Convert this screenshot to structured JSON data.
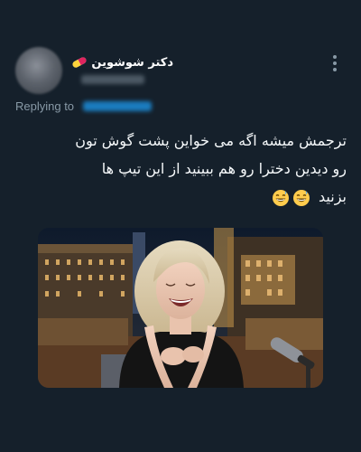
{
  "tweet": {
    "author_name": "دکتر شوشوین",
    "name_badge_icon": "pill-icon",
    "replying_label": "Replying to",
    "text_lines": [
      "ترجمش میشه اگه می خواین پشت گوش تون",
      "رو دیدین دخترا رو هم ببینید از این تیپ ها",
      "بزنید"
    ],
    "emoji": [
      "grinning-sweat-face",
      "grinning-sweat-face"
    ],
    "more_icon": "more-vertical-icon",
    "media_icon": "photo-laughing-woman"
  },
  "colors": {
    "background": "#15202b",
    "text": "#f5f8fa",
    "secondary": "#8899a6",
    "link": "#1d9bf0"
  }
}
